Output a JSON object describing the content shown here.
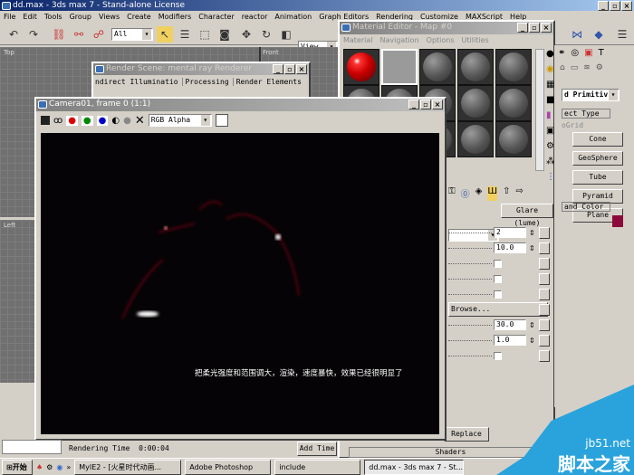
{
  "app": {
    "title": "dd.max - 3ds max 7 - Stand-alone License"
  },
  "menu": [
    "File",
    "Edit",
    "Tools",
    "Group",
    "Views",
    "Create",
    "Modifiers",
    "Character",
    "reactor",
    "Animation",
    "Graph Editors",
    "Rendering",
    "Customize",
    "MAXScript",
    "Help"
  ],
  "toolbar": {
    "selection_filter": "All",
    "coord_system": "View"
  },
  "viewports": {
    "top": "Top",
    "front": "Front",
    "left": "Left"
  },
  "render_scene": {
    "title": "Render Scene: mental ray Renderer",
    "tabs": [
      "ndirect Illuminatio",
      "Processing",
      "Render Elements"
    ]
  },
  "frame_window": {
    "title": "Camera01, frame 0 (1:1)",
    "channel": "RGB Alpha",
    "caption": "把柔光强度和范围调大，渲染，速度暴快，效果已经很明显了"
  },
  "material_editor": {
    "title": "Material Editor - Map #0",
    "menu": [
      "Material",
      "Navigation",
      "Options",
      "Utilities"
    ],
    "map_name": "Glare (lume)",
    "params": [
      {
        "type": "spin",
        "value": "2"
      },
      {
        "type": "spin",
        "value": "10.0"
      },
      {
        "type": "check"
      },
      {
        "type": "check"
      },
      {
        "type": "check"
      },
      {
        "type": "button",
        "value": "Browse..."
      },
      {
        "type": "spin",
        "value": "30.0"
      },
      {
        "type": "spin",
        "value": "1.0"
      },
      {
        "type": "check"
      }
    ],
    "replace_label": "Replace",
    "shaders_label": "Shaders"
  },
  "command_panel": {
    "category": "d Primitiv",
    "rollout_object_type": "ect Type",
    "autogrid": "oGrid",
    "buttons": [
      "Cone",
      "GeoSphere",
      "Tube",
      "Pyramid",
      "Plane"
    ],
    "rollout_name_color": "and Color",
    "name_color": "#8b0a3a"
  },
  "status": {
    "rendering_time_label": "Rendering Time",
    "rendering_time": "0:00:04",
    "add_time": "Add Time"
  },
  "taskbar": {
    "start": "开始",
    "items": [
      "MyIE2 - [火星时代动画...",
      "Adobe Photoshop",
      "include",
      "dd.max - 3ds max 7 - St..."
    ]
  },
  "watermark": {
    "site": "jb51.net",
    "name": "脚本之家"
  }
}
